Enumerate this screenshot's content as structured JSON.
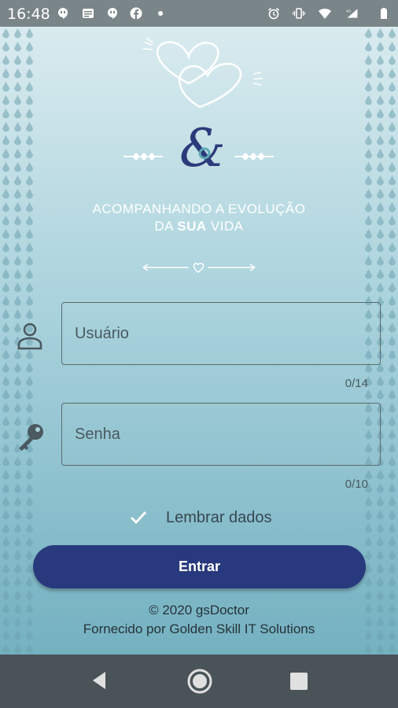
{
  "status_bar": {
    "time": "16:48",
    "icons_left": [
      "hangouts-icon",
      "news-icon",
      "hangouts-icon",
      "facebook-icon",
      "dot-icon"
    ],
    "icons_right": [
      "alarm-icon",
      "vibrate-icon",
      "wifi-icon",
      "signal-icon",
      "battery-icon"
    ],
    "network": "4G"
  },
  "branding": {
    "tagline_line1": "ACOMPANHANDO A EVOLUÇÃO",
    "tagline_line2_pre": "DA ",
    "tagline_line2_bold": "SUA",
    "tagline_line2_post": " VIDA"
  },
  "login": {
    "username_placeholder": "Usuário",
    "username_counter": "0/14",
    "password_placeholder": "Senha",
    "password_counter": "0/10",
    "remember_label": "Lembrar dados",
    "remember_checked": true,
    "enter_button": "Entrar"
  },
  "footer": {
    "copyright": "© 2020 gsDoctor",
    "provider": "Fornecido por Golden Skill IT Solutions"
  },
  "colors": {
    "primary_button": "#283a7d",
    "accent_ampersand": "#2b3a7a",
    "swirl": "#5fa9b5"
  }
}
